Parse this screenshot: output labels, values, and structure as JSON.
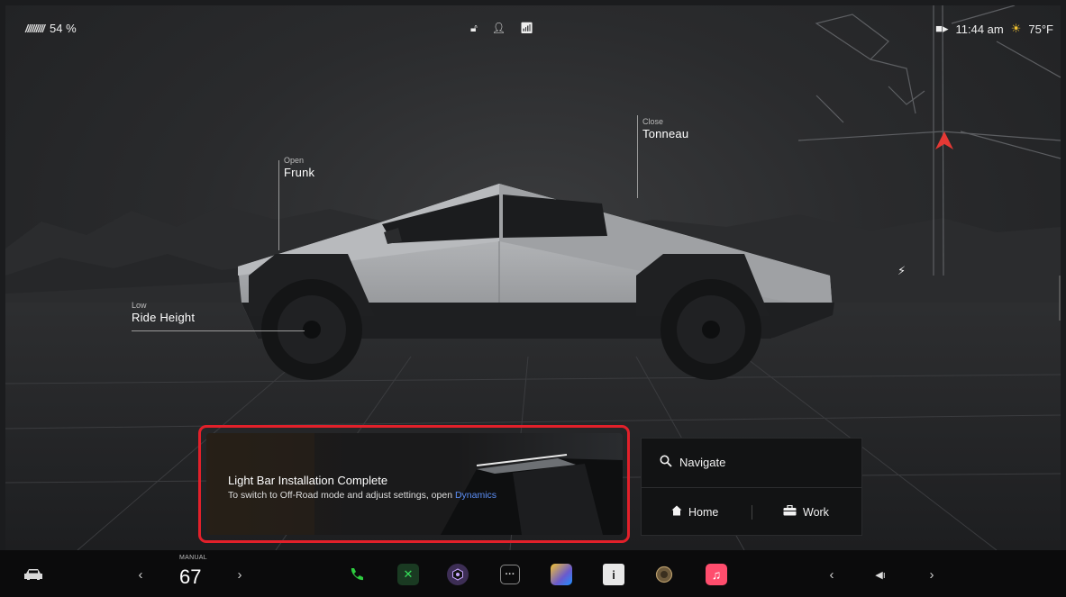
{
  "status": {
    "battery_percent": "54 %",
    "time": "11:44 am",
    "temperature": "75°F"
  },
  "callouts": {
    "frunk": {
      "small": "Open",
      "big": "Frunk"
    },
    "tonneau": {
      "small": "Close",
      "big": "Tonneau"
    },
    "ride_height": {
      "small": "Low",
      "big": "Ride Height"
    }
  },
  "notification": {
    "title": "Light Bar Installation Complete",
    "body": "To switch to Off-Road mode and adjust settings, open ",
    "link": "Dynamics"
  },
  "navigation": {
    "search_label": "Navigate",
    "home_label": "Home",
    "work_label": "Work"
  },
  "dock": {
    "climate_mode": "MANUAL",
    "climate_temp": "67"
  },
  "colors": {
    "highlight": "#e2202a",
    "link": "#5b8ef5",
    "nav_arrow": "#e53935"
  }
}
